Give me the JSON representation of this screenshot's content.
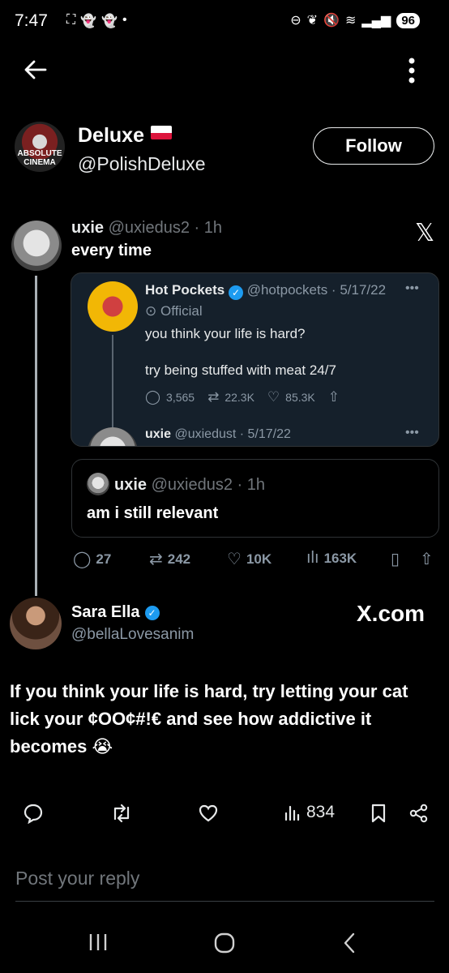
{
  "status_bar": {
    "time": "7:47",
    "battery": "96"
  },
  "header": {
    "name": "Deluxe",
    "handle": "@PolishDeluxe",
    "follow_label": "Follow",
    "avatar_text": "ABSOLUTE CINEMA"
  },
  "embedded_tweet": {
    "author_name": "uxie",
    "author_handle": "@uxiedus2",
    "time": "1h",
    "text": "every time",
    "quoted": {
      "author_name": "Hot Pockets",
      "author_handle": "@hotpockets",
      "date": "5/17/22",
      "official_label": "Official",
      "text_line1": "you think your life is hard?",
      "text_line2": "try being stuffed with meat 24/7",
      "replies": "3,565",
      "retweets": "22.3K",
      "likes": "85.3K",
      "next_author_name": "uxie",
      "next_author_handle": "@uxiedust",
      "next_date": "5/17/22"
    },
    "reply": {
      "author_name": "uxie",
      "author_handle": "@uxiedus2",
      "time": "1h",
      "text": "am i still relevant"
    },
    "actions": {
      "replies": "27",
      "retweets": "242",
      "likes": "10K",
      "views": "163K"
    }
  },
  "sara_tweet": {
    "author_name": "Sara Ella",
    "author_handle": "@bellaLovesanim",
    "watermark": "X.com",
    "text": "If you think your life is hard, try letting your cat lick your ¢OO¢#!€ and see how addictive it becomes 😭"
  },
  "action_bar": {
    "views": "834"
  },
  "reply_input": {
    "placeholder": "Post your reply"
  },
  "colors": {
    "background": "#000000",
    "verified": "#1d9bf0",
    "quote_card_bg": "#15202b"
  }
}
